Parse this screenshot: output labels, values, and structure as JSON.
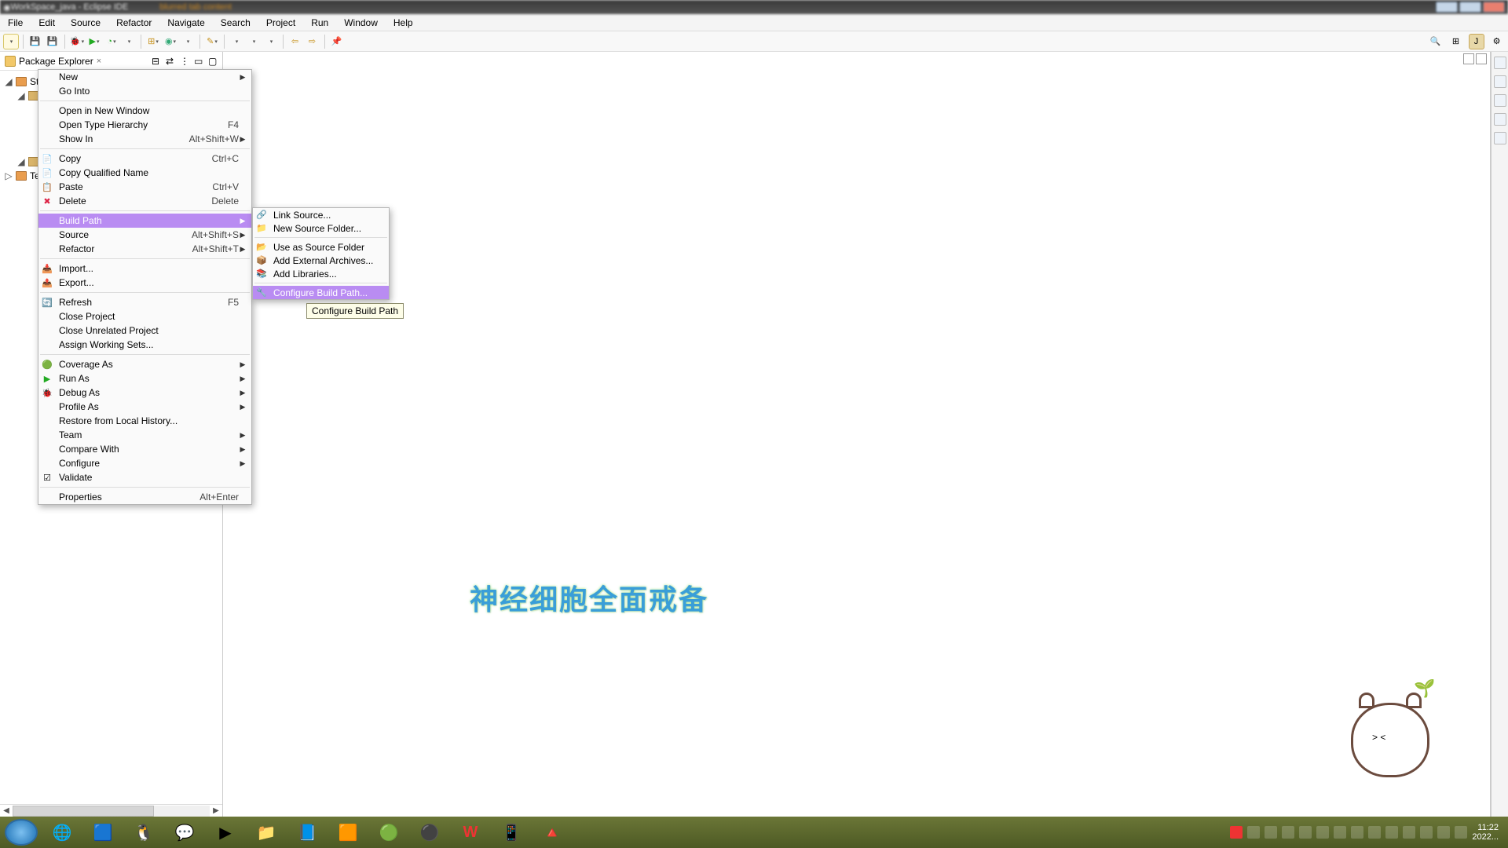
{
  "title": "WorkSpace_java - Eclipse IDE",
  "menubar": [
    "File",
    "Edit",
    "Source",
    "Refactor",
    "Navigate",
    "Search",
    "Project",
    "Run",
    "Window",
    "Help"
  ],
  "package_explorer": {
    "tab_label": "Package Explorer",
    "project": "Stu",
    "other_node": "Te"
  },
  "context_menu": [
    {
      "label": "New",
      "shortcut": "",
      "sub": true,
      "icon": ""
    },
    {
      "label": "Go Into",
      "shortcut": "",
      "sub": false,
      "icon": ""
    },
    {
      "hr": true
    },
    {
      "label": "Open in New Window",
      "shortcut": "",
      "sub": false,
      "icon": ""
    },
    {
      "label": "Open Type Hierarchy",
      "shortcut": "F4",
      "sub": false,
      "icon": ""
    },
    {
      "label": "Show In",
      "shortcut": "Alt+Shift+W",
      "sub": true,
      "icon": ""
    },
    {
      "hr": true
    },
    {
      "label": "Copy",
      "shortcut": "Ctrl+C",
      "sub": false,
      "icon": "📄"
    },
    {
      "label": "Copy Qualified Name",
      "shortcut": "",
      "sub": false,
      "icon": "📄"
    },
    {
      "label": "Paste",
      "shortcut": "Ctrl+V",
      "sub": false,
      "icon": "📋"
    },
    {
      "label": "Delete",
      "shortcut": "Delete",
      "sub": false,
      "icon": "✖",
      "iconcolor": "#d24"
    },
    {
      "hr": true
    },
    {
      "label": "Build Path",
      "shortcut": "",
      "sub": true,
      "icon": "",
      "hl": true
    },
    {
      "label": "Source",
      "shortcut": "Alt+Shift+S",
      "sub": true,
      "icon": ""
    },
    {
      "label": "Refactor",
      "shortcut": "Alt+Shift+T",
      "sub": true,
      "icon": ""
    },
    {
      "hr": true
    },
    {
      "label": "Import...",
      "shortcut": "",
      "sub": false,
      "icon": "📥"
    },
    {
      "label": "Export...",
      "shortcut": "",
      "sub": false,
      "icon": "📤"
    },
    {
      "hr": true
    },
    {
      "label": "Refresh",
      "shortcut": "F5",
      "sub": false,
      "icon": "🔄"
    },
    {
      "label": "Close Project",
      "shortcut": "",
      "sub": false,
      "icon": ""
    },
    {
      "label": "Close Unrelated Project",
      "shortcut": "",
      "sub": false,
      "icon": ""
    },
    {
      "label": "Assign Working Sets...",
      "shortcut": "",
      "sub": false,
      "icon": ""
    },
    {
      "hr": true
    },
    {
      "label": "Coverage As",
      "shortcut": "",
      "sub": true,
      "icon": "🟢"
    },
    {
      "label": "Run As",
      "shortcut": "",
      "sub": true,
      "icon": "▶",
      "iconcolor": "#2a2"
    },
    {
      "label": "Debug As",
      "shortcut": "",
      "sub": true,
      "icon": "🐞",
      "iconcolor": "#2a6"
    },
    {
      "label": "Profile As",
      "shortcut": "",
      "sub": true,
      "icon": ""
    },
    {
      "label": "Restore from Local History...",
      "shortcut": "",
      "sub": false,
      "icon": ""
    },
    {
      "label": "Team",
      "shortcut": "",
      "sub": true,
      "icon": ""
    },
    {
      "label": "Compare With",
      "shortcut": "",
      "sub": true,
      "icon": ""
    },
    {
      "label": "Configure",
      "shortcut": "",
      "sub": true,
      "icon": ""
    },
    {
      "label": "Validate",
      "shortcut": "",
      "sub": false,
      "icon": "☑"
    },
    {
      "hr": true
    },
    {
      "label": "Properties",
      "shortcut": "Alt+Enter",
      "sub": false,
      "icon": ""
    }
  ],
  "submenu": [
    {
      "label": "Link Source...",
      "icon": "🔗"
    },
    {
      "label": "New Source Folder...",
      "icon": "📁"
    },
    {
      "hr": true
    },
    {
      "label": "Use as Source Folder",
      "icon": "📂"
    },
    {
      "label": "Add External Archives...",
      "icon": "📦"
    },
    {
      "label": "Add Libraries...",
      "icon": "📚"
    },
    {
      "hr": true
    },
    {
      "label": "Configure Build Path...",
      "icon": "🔧",
      "hl": true
    }
  ],
  "tooltip": "Configure Build Path",
  "caption": "神经细胞全面戒备",
  "clock": {
    "time": "11:22",
    "date": "2022..."
  }
}
